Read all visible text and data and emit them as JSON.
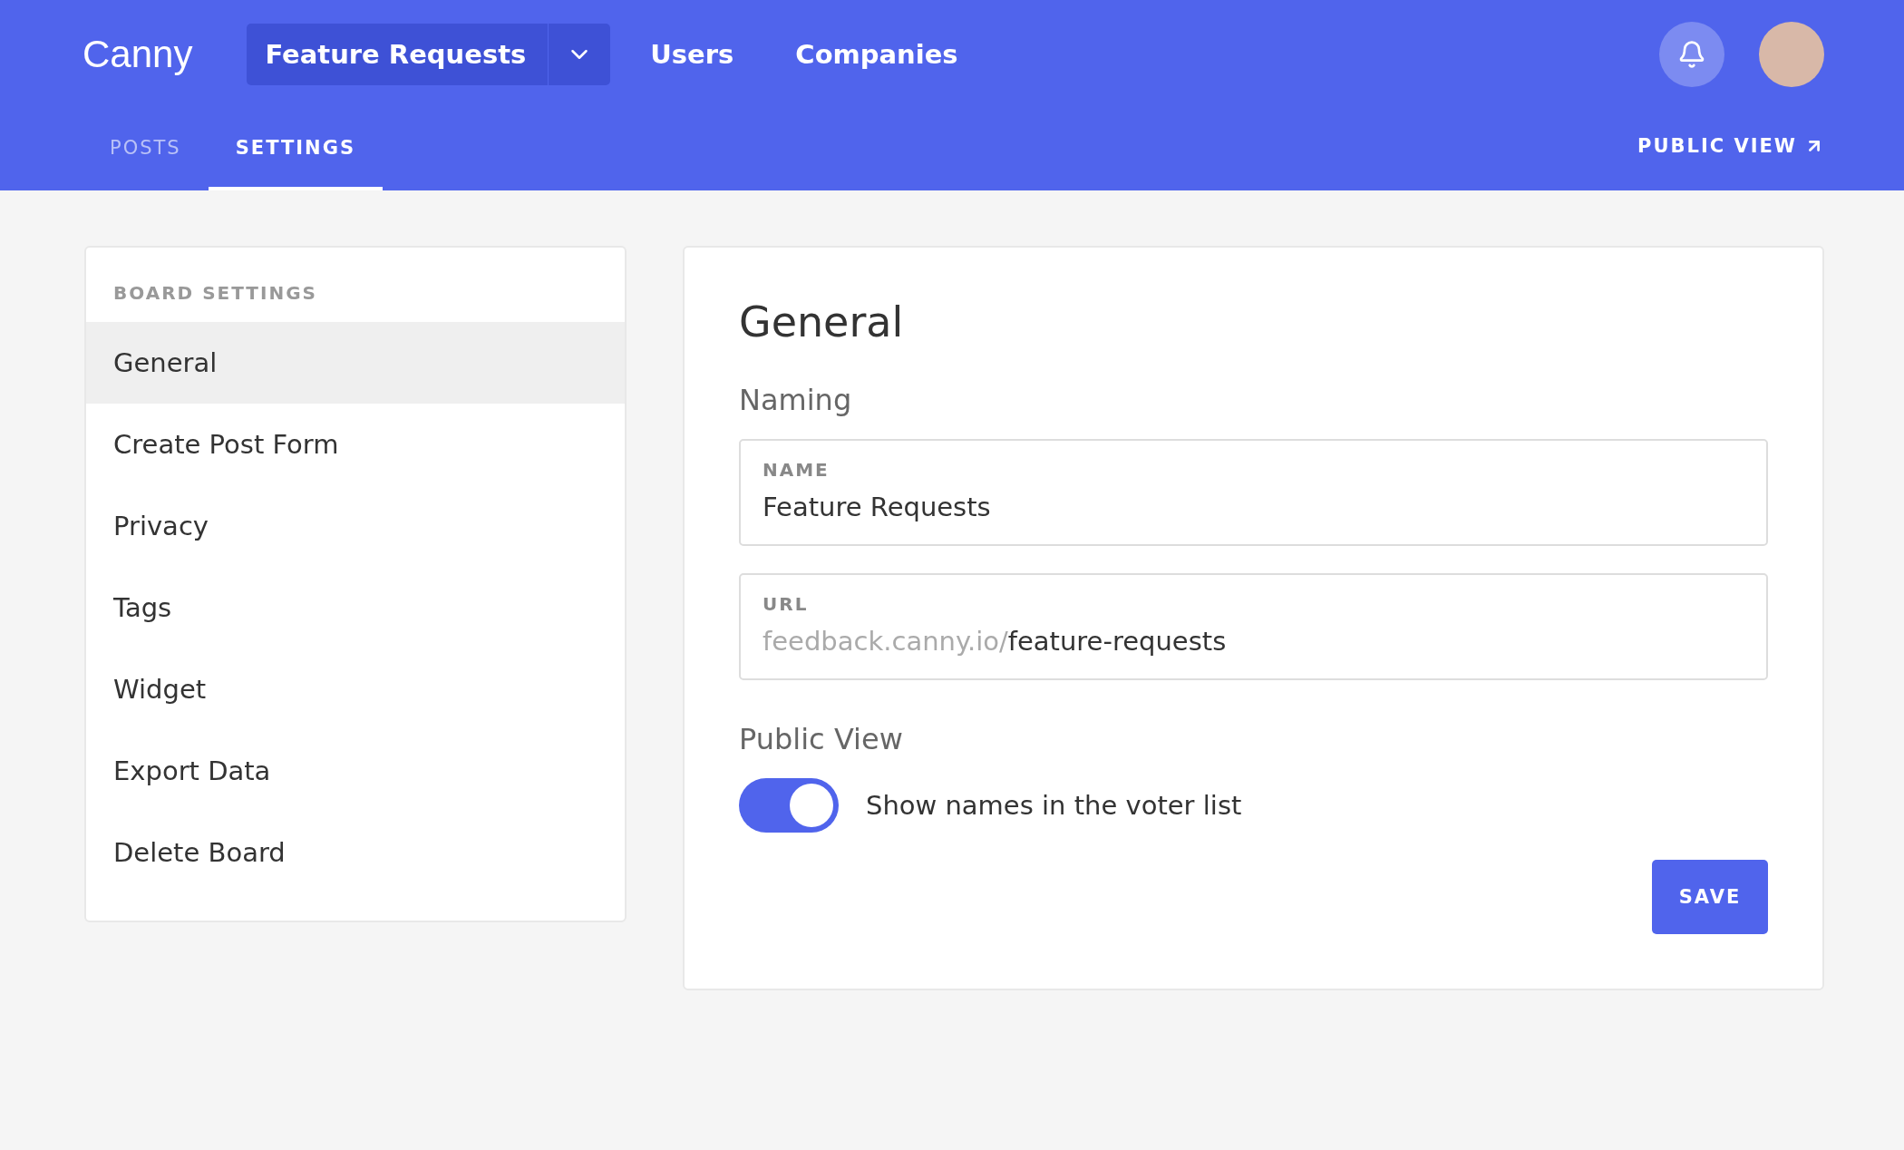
{
  "header": {
    "logo": "Canny",
    "board_switcher": {
      "label": "Feature Requests"
    },
    "nav_links": [
      {
        "label": "Users"
      },
      {
        "label": "Companies"
      }
    ],
    "tabs": [
      {
        "label": "POSTS",
        "selected": false
      },
      {
        "label": "SETTINGS",
        "selected": true
      }
    ],
    "public_view_link": "PUBLIC VIEW"
  },
  "sidebar": {
    "heading": "BOARD SETTINGS",
    "items": [
      {
        "label": "General",
        "selected": true
      },
      {
        "label": "Create Post Form",
        "selected": false
      },
      {
        "label": "Privacy",
        "selected": false
      },
      {
        "label": "Tags",
        "selected": false
      },
      {
        "label": "Widget",
        "selected": false
      },
      {
        "label": "Export Data",
        "selected": false
      },
      {
        "label": "Delete Board",
        "selected": false
      }
    ]
  },
  "main": {
    "title": "General",
    "naming": {
      "heading": "Naming",
      "name_field": {
        "label": "NAME",
        "value": "Feature Requests"
      },
      "url_field": {
        "label": "URL",
        "prefix": "feedback.canny.io/",
        "value": "feature-requests"
      }
    },
    "public_view": {
      "heading": "Public View",
      "toggle": {
        "label": "Show names in the voter list",
        "on": true
      }
    },
    "save_button": "SAVE"
  }
}
